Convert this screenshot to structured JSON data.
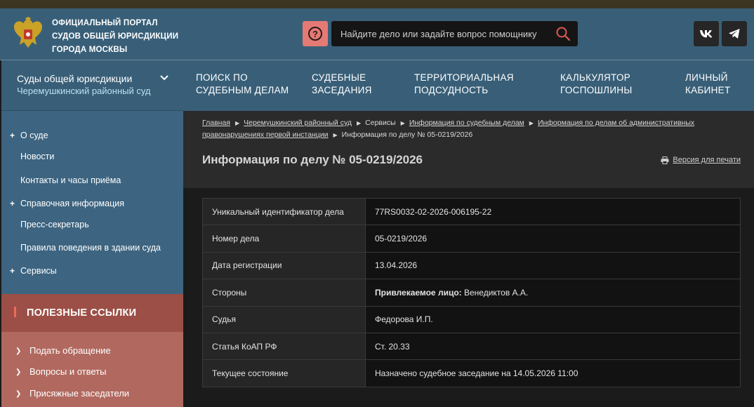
{
  "header": {
    "title_lines": [
      "ОФИЦИАЛЬНЫЙ ПОРТАЛ",
      "СУДОВ ОБЩЕЙ ЮРИСДИКЦИИ",
      "ГОРОДА МОСКВЫ"
    ],
    "help_icon": "?",
    "search_placeholder": "Найдите дело или задайте вопрос помощнику",
    "social": {
      "vk": "vk",
      "telegram": "telegram"
    }
  },
  "sidebar": {
    "heading": "Суды общей юрисдикции",
    "court": "Черемушкинский районный суд",
    "items": [
      {
        "label": "О суде",
        "expandable": true
      },
      {
        "label": "Новости",
        "expandable": false
      },
      {
        "label": "Контакты и часы приёма",
        "expandable": false
      },
      {
        "label": "Справочная информация",
        "expandable": true
      },
      {
        "label": "Пресс-секретарь",
        "expandable": false
      },
      {
        "label": "Правила поведения в здании суда",
        "expandable": false
      },
      {
        "label": "Сервисы",
        "expandable": true
      }
    ],
    "useful_title": "ПОЛЕЗНЫЕ ССЫЛКИ",
    "useful_links": [
      "Подать обращение",
      "Вопросы и ответы",
      "Присяжные заседатели"
    ]
  },
  "nav": [
    {
      "line1": "ПОИСК ПО",
      "line2": "СУДЕБНЫМ ДЕЛАМ"
    },
    {
      "line1": "СУДЕБНЫЕ",
      "line2": "ЗАСЕДАНИЯ"
    },
    {
      "line1": "ТЕРРИТОРИАЛЬНАЯ",
      "line2": "ПОДСУДНОСТЬ"
    },
    {
      "line1": "КАЛЬКУЛЯТОР",
      "line2": "ГОСПОШЛИНЫ"
    },
    {
      "line1": "ЛИЧНЫЙ",
      "line2": "КАБИНЕТ"
    }
  ],
  "breadcrumbs": {
    "items": [
      "Главная",
      "Черемушкинский районный суд",
      "Сервисы",
      "Информация по судебным делам",
      "Информация по делам об административных",
      "правонарушениях первой инстанции"
    ],
    "current": "Информация по делу № 05-0219/2026"
  },
  "page": {
    "title": "Информация по делу № 05-0219/2026",
    "print_label": "Версия для печати"
  },
  "case": {
    "rows": [
      {
        "label": "Уникальный идентификатор дела",
        "value": "77RS0032-02-2026-006195-22"
      },
      {
        "label": "Номер дела",
        "value": "05-0219/2026"
      },
      {
        "label": "Дата регистрации",
        "value": "13.04.2026"
      },
      {
        "label": "Стороны",
        "value_bold": "Привлекаемое лицо:",
        "value": "Венедиктов А.А."
      },
      {
        "label": "Судья",
        "value": "Федорова И.П."
      },
      {
        "label": "Статья КоАП РФ",
        "value": "Ст. 20.33"
      },
      {
        "label": "Текущее состояние",
        "value": "Назначено судебное заседание на 14.05.2026 11:00"
      }
    ]
  },
  "colors": {
    "header_bg": "#395f78",
    "accent_red": "#e57a74",
    "useful_bg": "#b1695f",
    "content_bg": "#1b1b1b"
  }
}
